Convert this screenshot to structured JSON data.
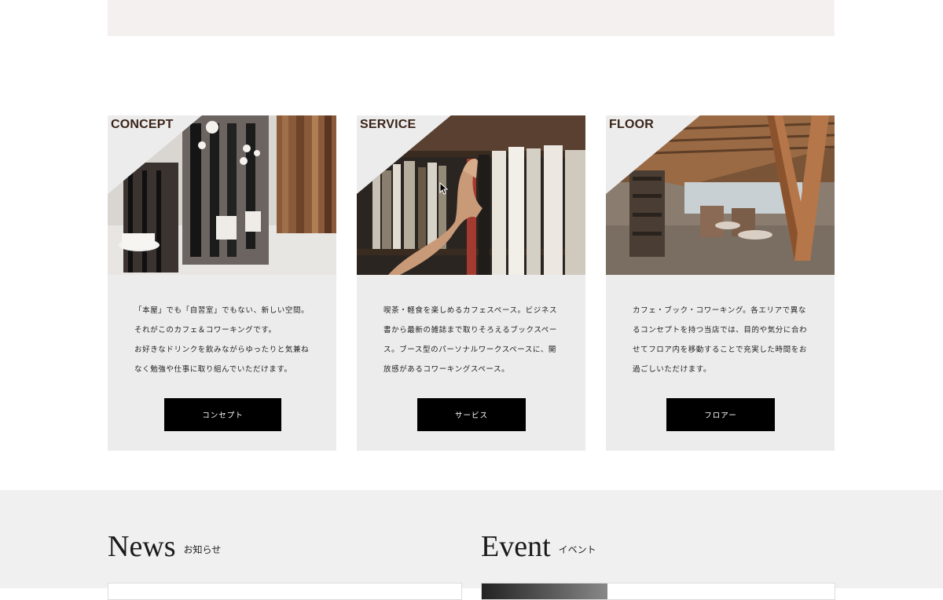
{
  "cards": [
    {
      "label": "CONCEPT",
      "text": "「本屋」でも「自習室」でもない、新しい空間。\nそれがこのカフェ＆コワーキングです。\nお好きなドリンクを飲みながらゆったりと気兼ね\nなく勉強や仕事に取り組んでいただけます。",
      "button": "コンセプト"
    },
    {
      "label": "SERVICE",
      "text": "喫茶・軽食を楽しめるカフェスペース。ビジネス\n書から最新の雑誌まで取りそろえるブックスペー\nス。ブース型のパーソナルワークスペースに、開\n放感があるコワーキングスペース。",
      "button": "サービス"
    },
    {
      "label": "FLOOR",
      "text": "カフェ・ブック・コワーキング。各エリアで異な\nるコンセプトを持つ当店では、目的や気分に合わ\nせてフロア内を移動することで充実した時間をお\n過ごしいただけます。",
      "button": "フロアー"
    }
  ],
  "news": {
    "title": "News",
    "subtitle": "お知らせ"
  },
  "event": {
    "title": "Event",
    "subtitle": "イベント"
  },
  "colors": {
    "label": "#3a2418",
    "card_bg": "#ececec",
    "button_bg": "#000000",
    "band_top": "#f4f0f0",
    "band_bottom": "#f0f0f0"
  }
}
